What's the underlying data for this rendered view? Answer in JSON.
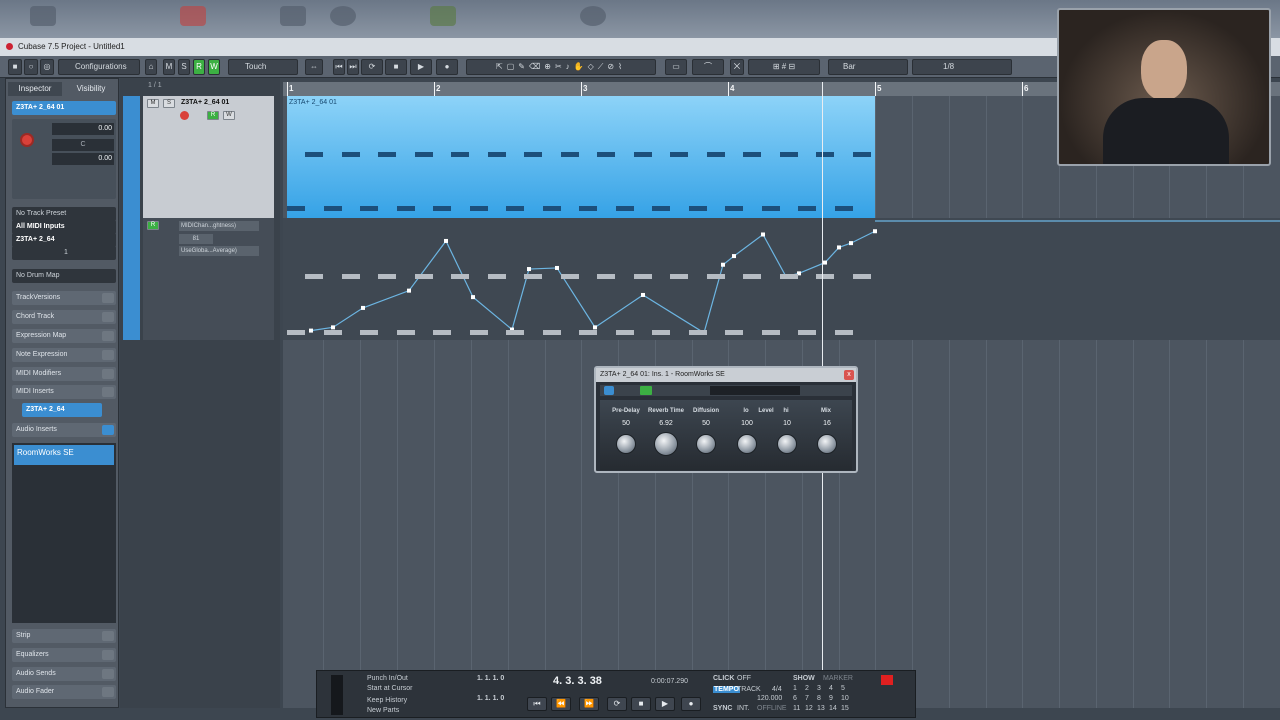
{
  "window": {
    "title": "Cubase 7.5 Project - Untitled1"
  },
  "toolbar": {
    "m_label": "M",
    "s_label": "S",
    "r_label": "R",
    "w_label": "W",
    "configurations": "Configurations",
    "automation_mode": "Touch",
    "grid_type": "Bar",
    "quantize": "1/8"
  },
  "inspector": {
    "tabs": [
      "Inspector",
      "Visibility"
    ],
    "track_name": "Z3TA+ 2_64 01",
    "volume": "0.00",
    "pan": "C",
    "transpose": "0.00",
    "no_track_preset": "No Track Preset",
    "input": "All MIDI Inputs",
    "output": "Z3TA+ 2_64",
    "channel": "1",
    "no_drum_map": "No Drum Map",
    "sections": [
      "TrackVersions",
      "Chord Track",
      "Expression Map",
      "Note Expression",
      "MIDI Modifiers",
      "MIDI Inserts"
    ],
    "instrument_slot": "Z3TA+ 2_64",
    "audio_inserts": "Audio Inserts",
    "insert_slot": "RoomWorks SE",
    "bottom_sections": [
      "Strip",
      "Equalizers",
      "Audio Sends",
      "Audio Fader"
    ]
  },
  "tracklist": {
    "page": "1 / 1",
    "track_name": "Z3TA+ 2_64 01",
    "lane_param": "MIDIChan...ghtness)",
    "lane_value": "81",
    "lane_mode": "UseGloba...Average)"
  },
  "ruler": {
    "bars": [
      "1",
      "2",
      "3",
      "4",
      "5",
      "6"
    ]
  },
  "part": {
    "name": "Z3TA+ 2_64 01"
  },
  "plugin": {
    "title": "Z3TA+ 2_64 01: Ins. 1 - RoomWorks SE",
    "close_label": "x",
    "params": [
      {
        "label": "Pre-Delay",
        "value": "50"
      },
      {
        "label": "Reverb Time",
        "value": "6.92"
      },
      {
        "label": "Diffusion",
        "value": "50"
      },
      {
        "label": "lo",
        "value": "100"
      },
      {
        "label": "Level",
        "value": "10"
      },
      {
        "label": "hi",
        "value": ""
      },
      {
        "label": "Mix",
        "value": "16"
      }
    ]
  },
  "transport": {
    "punch": "Punch In/Out",
    "start_cursor": "Start at Cursor",
    "keep_history": "Keep History",
    "new_parts": "New Parts",
    "left_locator": "1. 1. 1.   0",
    "right_locator": "1. 1. 1.   0",
    "position": "4. 3. 3. 38",
    "time": "0:00:07.290",
    "click_label": "CLICK",
    "click_value": "OFF",
    "tempo_label": "TEMPO",
    "tempo_mode": "TRACK",
    "signature": "4/4",
    "tempo_value": "120.000",
    "sync_label": "SYNC",
    "sync_mode": "INT.",
    "sync_state": "OFFLINE",
    "show_label": "SHOW",
    "marker_label": "MARKER",
    "markers": [
      "1",
      "2",
      "3",
      "4",
      "5",
      "6",
      "7",
      "8",
      "9",
      "10",
      "11",
      "12",
      "13",
      "14",
      "15"
    ]
  },
  "lane_automation": [
    0.05,
    0.08,
    0.26,
    0.42,
    0.88,
    0.36,
    0.06,
    0.62,
    0.63,
    0.08,
    0.38,
    0.03,
    0.66,
    0.74,
    0.94,
    0.55,
    0.58,
    0.68,
    0.82,
    0.86,
    0.97
  ]
}
